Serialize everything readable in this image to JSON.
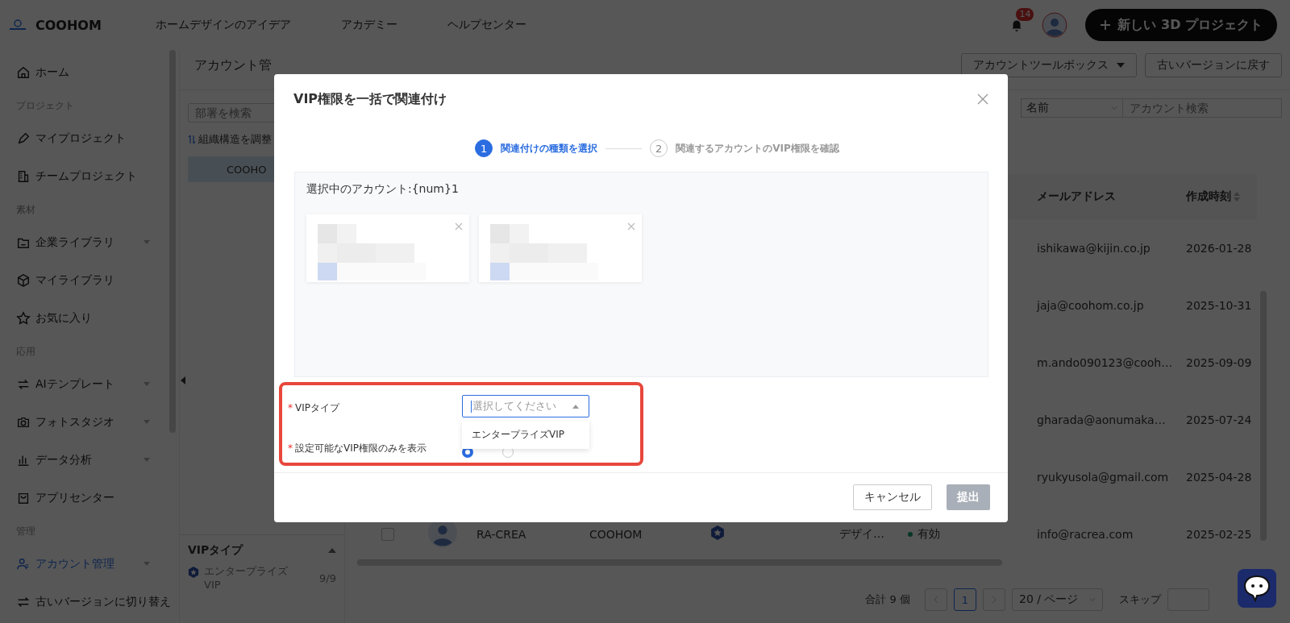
{
  "header": {
    "logo": "COOHOM",
    "nav": [
      "ホームデザインのアイデア",
      "アカデミー",
      "ヘルプセンター"
    ],
    "notification_count": "14",
    "new_project_button": "新しい 3D プロジェクト"
  },
  "sidebar": {
    "items": [
      {
        "kind": "item",
        "label": "ホーム",
        "selected": false,
        "expandable": false
      },
      {
        "kind": "section",
        "label": "プロジェクト"
      },
      {
        "kind": "item",
        "label": "マイプロジェクト",
        "selected": false,
        "expandable": false
      },
      {
        "kind": "item",
        "label": "チームプロジェクト",
        "selected": false,
        "expandable": false
      },
      {
        "kind": "section",
        "label": "素材"
      },
      {
        "kind": "item",
        "label": "企業ライブラリ",
        "selected": false,
        "expandable": true
      },
      {
        "kind": "item",
        "label": "マイライブラリ",
        "selected": false,
        "expandable": false
      },
      {
        "kind": "item",
        "label": "お気に入り",
        "selected": false,
        "expandable": false
      },
      {
        "kind": "section",
        "label": "応用"
      },
      {
        "kind": "item",
        "label": "AIテンプレート",
        "selected": false,
        "expandable": true
      },
      {
        "kind": "item",
        "label": "フォトスタジオ",
        "selected": false,
        "expandable": true
      },
      {
        "kind": "item",
        "label": "データ分析",
        "selected": false,
        "expandable": true
      },
      {
        "kind": "item",
        "label": "アプリセンター",
        "selected": false,
        "expandable": false
      },
      {
        "kind": "section",
        "label": "管理"
      },
      {
        "kind": "item",
        "label": "アカウント管理",
        "selected": true,
        "expandable": true
      },
      {
        "kind": "item",
        "label": "古いバージョンに切り替え",
        "selected": false,
        "expandable": false
      }
    ]
  },
  "page": {
    "title": "アカウント管",
    "toolbox_button": "アカウントツールボックス",
    "revert_button": "古いバージョンに戻す"
  },
  "departments": {
    "search_placeholder": "部署を検索",
    "adjust_link": "組織構造を調整",
    "tree": [
      {
        "label": "COOHO",
        "selected": true
      }
    ],
    "vip_filter": {
      "title": "VIPタイプ",
      "items": [
        {
          "label": "エンタープライズVIP",
          "count": "9/9"
        }
      ]
    }
  },
  "filters": {
    "field_select": "名前",
    "search_placeholder": "アカウント検索"
  },
  "table": {
    "columns": [
      {
        "label": "メールアドレス",
        "sortable": false
      },
      {
        "label": "作成時刻",
        "sortable": true
      }
    ],
    "rows": [
      {
        "email": "ishikawa@kijin.co.jp",
        "created": "2026-01-28"
      },
      {
        "email": "jaja@coohom.co.jp",
        "created": "2025-10-31"
      },
      {
        "email": "m.ando090123@cooh…",
        "created": "2025-09-09"
      },
      {
        "email": "gharada@aonumaka…",
        "created": "2025-07-24"
      },
      {
        "email": "ryukyusola@gmail.com",
        "created": "2025-04-28"
      },
      {
        "checked": false,
        "name": "RA-CREA",
        "organization": "COOHOM",
        "role": "デザイ…",
        "status": "有効",
        "active": true,
        "email": "info@racrea.com",
        "created": "2025-02-25"
      }
    ]
  },
  "pagination": {
    "total": "合計 9 個",
    "pages": [
      {
        "label": "1",
        "selected": true
      }
    ],
    "page_size": "20 / ページ",
    "jump_label": "スキップ"
  },
  "modal": {
    "title": "VIP権限を一括で関連付け",
    "steps": [
      {
        "number": "1",
        "label": "関連付けの種類を選択",
        "selected": true
      },
      {
        "number": "2",
        "label": "関連するアカウントのVIP権限を確認",
        "selected": false
      }
    ],
    "selected_accounts_label": "選択中のアカウント:{num}1",
    "account_cards": [
      {
        "kind": "blurred"
      },
      {
        "kind": "blurred"
      }
    ],
    "fields": [
      {
        "label": "VIPタイプ",
        "required_mark": "*",
        "placeholder": "選択してください",
        "options": [
          "エンタープライズVIP"
        ]
      },
      {
        "label": "設定可能なVIP権限のみを表示",
        "required_mark": "*",
        "radios": [
          {
            "selected": true
          },
          {
            "selected": false
          }
        ]
      }
    ],
    "cancel_button": "キャンセル",
    "submit_button": "提出",
    "submit_disabled": true
  }
}
